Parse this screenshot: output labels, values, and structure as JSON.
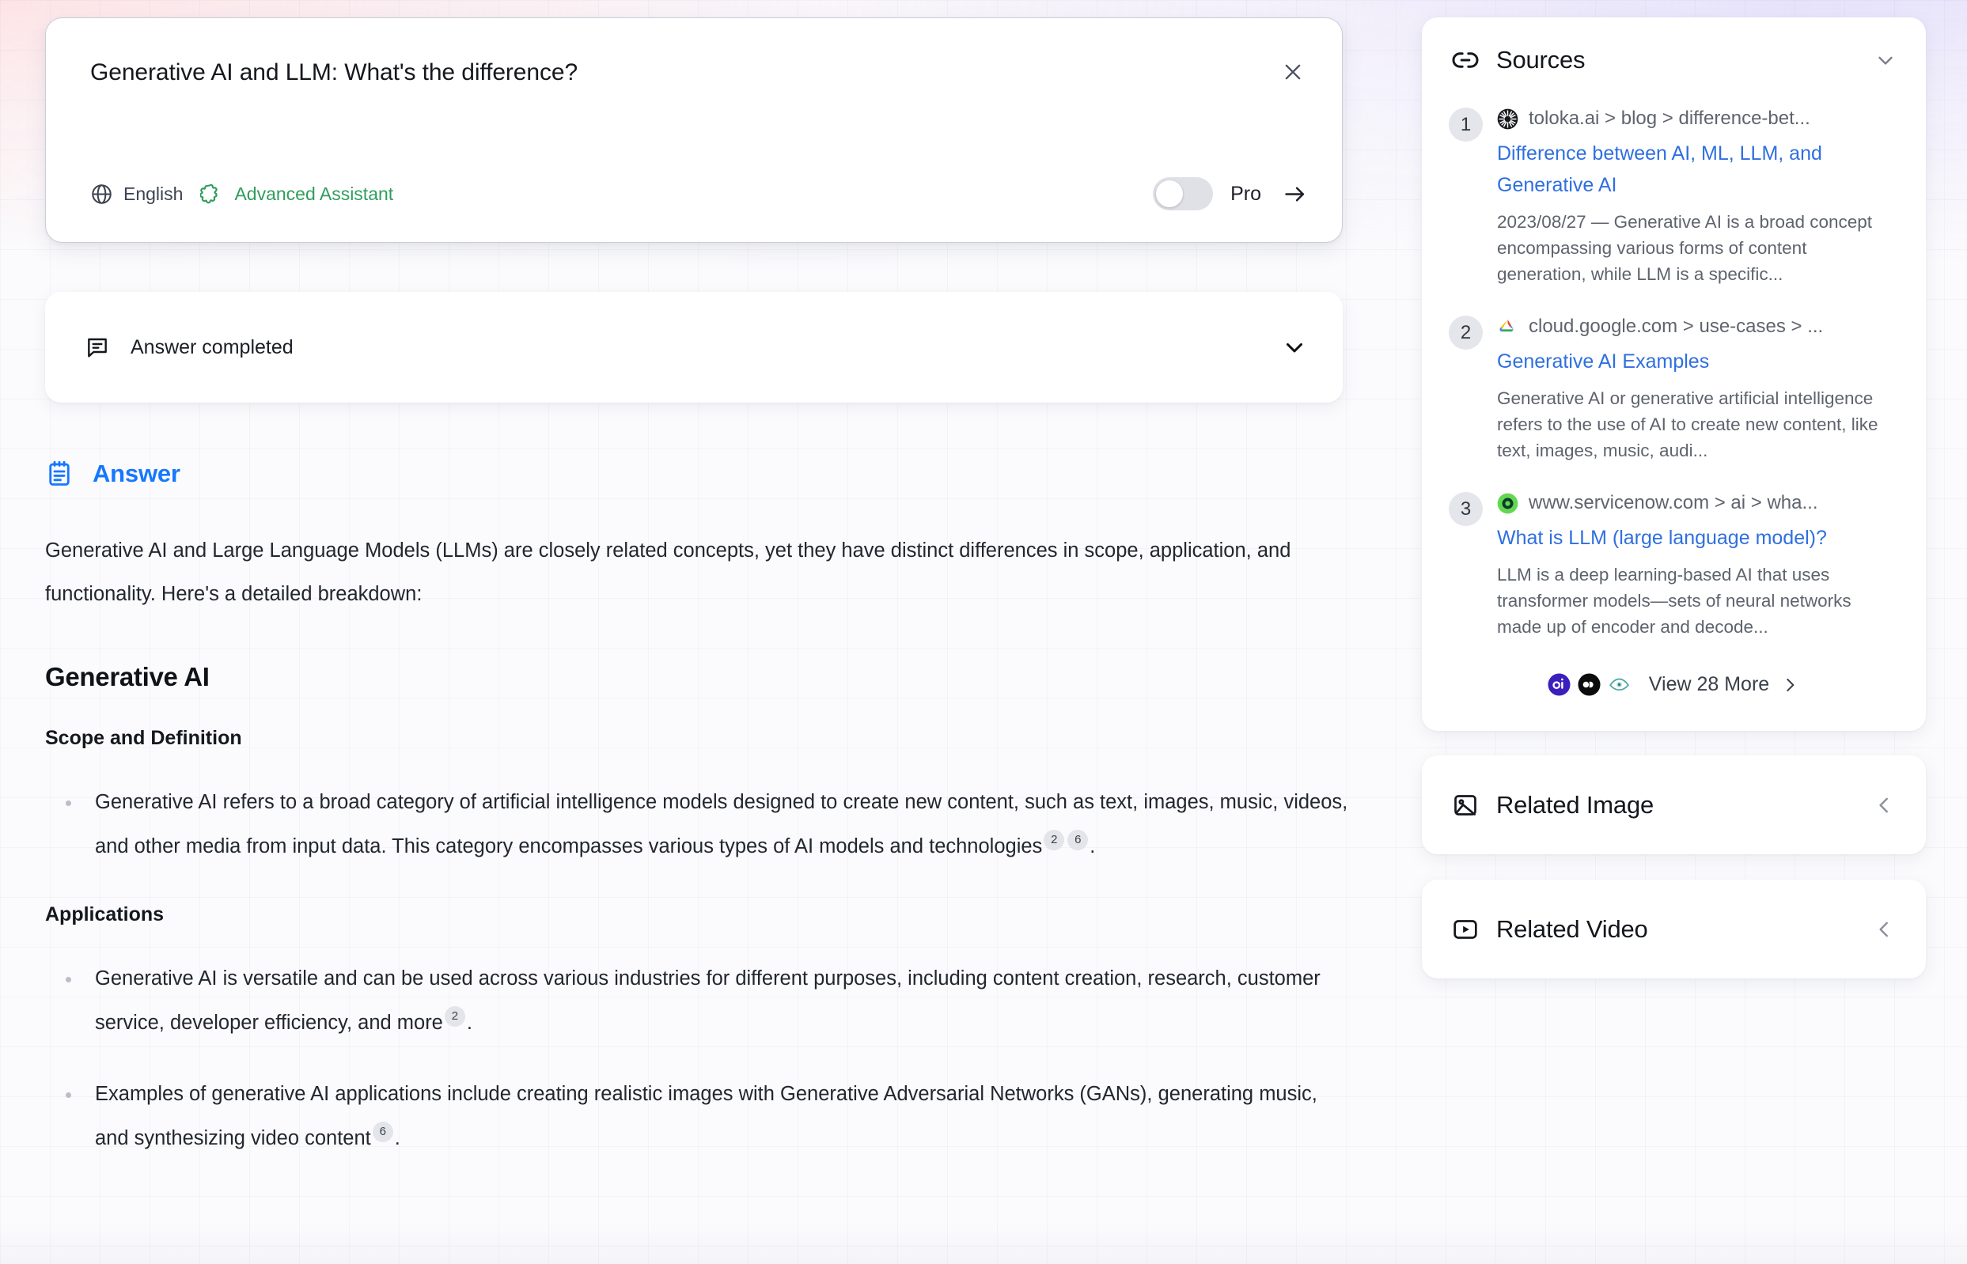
{
  "query_card": {
    "query_text": "Generative AI and LLM: What's the difference?",
    "close_icon": "close-icon",
    "language_icon": "globe-icon",
    "language_label": "English",
    "assistant_icon": "puzzle-piece-icon",
    "assistant_label": "Advanced Assistant",
    "pro_toggle_state": "off",
    "pro_label": "Pro",
    "submit_icon": "arrow-right-icon"
  },
  "status_card": {
    "status_icon": "chat-bubble-icon",
    "status_label": "Answer completed",
    "chevron_icon": "chevron-down-icon"
  },
  "answer": {
    "header_icon": "notepad-icon",
    "header_label": "Answer",
    "intro": "Generative AI and Large Language Models (LLMs) are closely related concepts, yet they have distinct differences in scope, application, and functionality. Here's a detailed breakdown:",
    "section_title": "Generative AI",
    "sub1_title": "Scope and Definition",
    "bullet1_text": "Generative AI refers to a broad category of artificial intelligence models designed to create new content, such as text, images, music, videos, and other media from input data. This category encompasses various types of AI models and technologies",
    "bullet1_cites": [
      "2",
      "6"
    ],
    "sub2_title": "Applications",
    "bullet2_text": "Generative AI is versatile and can be used across various industries for different purposes, including content creation, research, customer service, developer efficiency, and more",
    "bullet2_cites": [
      "2"
    ],
    "bullet3_text": "Examples of generative AI applications include creating realistic images with Generative Adversarial Networks (GANs), generating music, and synthesizing video content",
    "bullet3_cites": [
      "6"
    ]
  },
  "sources_panel": {
    "link_icon": "link-icon",
    "title": "Sources",
    "chevron_icon": "chevron-down-icon",
    "items": [
      {
        "number": "1",
        "favicon": "toloka-starburst-icon",
        "domain": "toloka.ai > blog > difference-bet...",
        "title": "Difference between AI, ML, LLM, and Generative AI",
        "snippet": "2023/08/27 — Generative AI is a broad concept encompassing various forms of content generation, while LLM is a specific..."
      },
      {
        "number": "2",
        "favicon": "google-cloud-icon",
        "domain": "cloud.google.com > use-cases > ...",
        "title": "Generative AI Examples",
        "snippet": "Generative AI or generative artificial intelligence refers to the use of AI to create new content, like text, images, music, audi..."
      },
      {
        "number": "3",
        "favicon": "servicenow-icon",
        "domain": "www.servicenow.com > ai > wha...",
        "title": "What is LLM (large language model)?",
        "snippet": "LLM is a deep learning-based AI that uses transformer models—sets of neural networks made up of encoder and decode..."
      }
    ],
    "view_more_avatars": [
      "ai-circle-icon",
      "black-circle-icon",
      "teal-eye-icon"
    ],
    "view_more_label": "View 28 More",
    "view_more_chevron": "chevron-right-icon"
  },
  "related_image_panel": {
    "icon": "image-icon",
    "title": "Related Image",
    "chevron_icon": "chevron-left-icon"
  },
  "related_video_panel": {
    "icon": "video-play-icon",
    "title": "Related Video",
    "chevron_icon": "chevron-left-icon"
  },
  "colors": {
    "accent_blue": "#1677ff",
    "link_blue": "#2f6fe0",
    "assistant_green": "#2f9e5c",
    "muted_text": "#5e636d",
    "body_text": "#22262e",
    "toggle_off": "#dfe1e6"
  }
}
